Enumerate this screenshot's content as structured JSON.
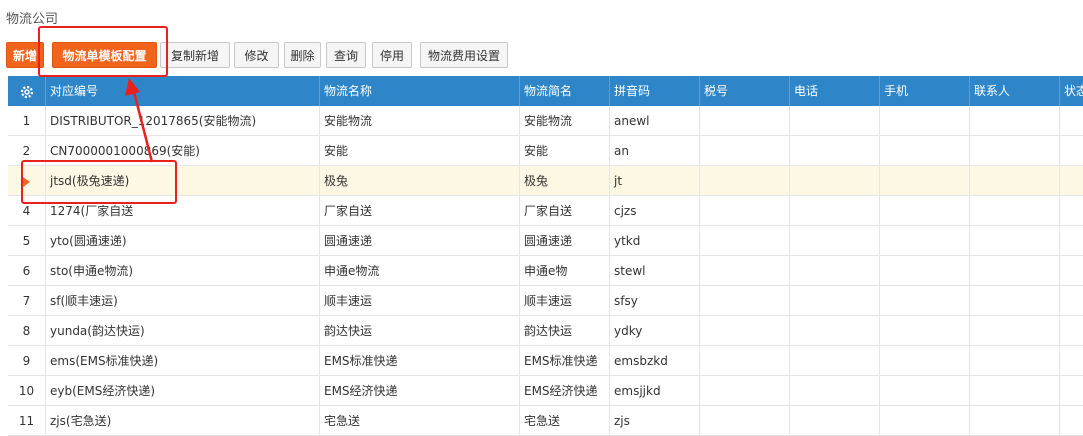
{
  "page": {
    "title": "物流公司"
  },
  "toolbar": {
    "buttons": [
      {
        "label": "新增"
      },
      {
        "label": "物流单模板配置"
      },
      {
        "label": "复制新增"
      },
      {
        "label": "修改"
      },
      {
        "label": "删除"
      },
      {
        "label": "查询"
      },
      {
        "label": "停用"
      },
      {
        "label": "物流费用设置"
      }
    ]
  },
  "table": {
    "columns": [
      "对应编号",
      "物流名称",
      "物流简名",
      "拼音码",
      "税号",
      "电话",
      "手机",
      "联系人",
      "状态"
    ],
    "selected_row": 3,
    "rows": [
      {
        "n": "1",
        "code": "DISTRIBUTOR_12017865(安能物流)",
        "name": "安能物流",
        "short": "安能物流",
        "py": "anewl"
      },
      {
        "n": "2",
        "code": "CN7000001000869(安能)",
        "name": "安能",
        "short": "安能",
        "py": "an"
      },
      {
        "n": "",
        "code": "jtsd(极兔速递)",
        "name": "极兔",
        "short": "极兔",
        "py": "jt"
      },
      {
        "n": "4",
        "code": "1274(厂家自送",
        "name": "厂家自送",
        "short": "厂家自送",
        "py": "cjzs"
      },
      {
        "n": "5",
        "code": "yto(圆通速递)",
        "name": "圆通速递",
        "short": "圆通速递",
        "py": "ytkd"
      },
      {
        "n": "6",
        "code": "sto(申通e物流)",
        "name": "申通e物流",
        "short": "申通e物",
        "py": "stewl"
      },
      {
        "n": "7",
        "code": "sf(顺丰速运)",
        "name": "顺丰速运",
        "short": "顺丰速运",
        "py": "sfsy"
      },
      {
        "n": "8",
        "code": "yunda(韵达快运)",
        "name": "韵达快运",
        "short": "韵达快运",
        "py": "ydky"
      },
      {
        "n": "9",
        "code": "ems(EMS标准快递)",
        "name": "EMS标准快递",
        "short": "EMS标准快递",
        "py": "emsbzkd"
      },
      {
        "n": "10",
        "code": "eyb(EMS经济快递)",
        "name": "EMS经济快递",
        "short": "EMS经济快递",
        "py": "emsjjkd"
      },
      {
        "n": "11",
        "code": "zjs(宅急送)",
        "name": "宅急送",
        "short": "宅急送",
        "py": "zjs"
      }
    ]
  },
  "colors": {
    "accent": "#f0641e",
    "header": "#2e86c9",
    "annotation": "#e8211d",
    "selected_row": "#fdf8e4"
  }
}
